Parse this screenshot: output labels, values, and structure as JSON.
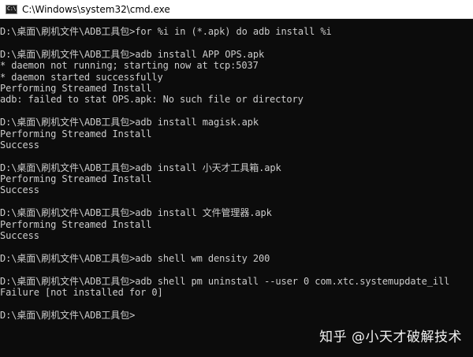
{
  "window": {
    "title": "C:\\Windows\\system32\\cmd.exe",
    "icon_label": "C:\\"
  },
  "console": {
    "lines": [
      "D:\\桌面\\刷机文件\\ADB工具包>for %i in (*.apk) do adb install %i",
      "",
      "D:\\桌面\\刷机文件\\ADB工具包>adb install APP OPS.apk",
      "* daemon not running; starting now at tcp:5037",
      "* daemon started successfully",
      "Performing Streamed Install",
      "adb: failed to stat OPS.apk: No such file or directory",
      "",
      "D:\\桌面\\刷机文件\\ADB工具包>adb install magisk.apk",
      "Performing Streamed Install",
      "Success",
      "",
      "D:\\桌面\\刷机文件\\ADB工具包>adb install 小天才工具箱.apk",
      "Performing Streamed Install",
      "Success",
      "",
      "D:\\桌面\\刷机文件\\ADB工具包>adb install 文件管理器.apk",
      "Performing Streamed Install",
      "Success",
      "",
      "D:\\桌面\\刷机文件\\ADB工具包>adb shell wm density 200",
      "",
      "D:\\桌面\\刷机文件\\ADB工具包>adb shell pm uninstall --user 0 com.xtc.systemupdate_ill",
      "Failure [not installed for 0]",
      "",
      "D:\\桌面\\刷机文件\\ADB工具包>"
    ]
  },
  "watermark": "知乎 @小天才破解技术",
  "colors": {
    "console_bg": "#0c0c0c",
    "console_text": "#cccccc",
    "titlebar_bg": "#ffffff"
  }
}
